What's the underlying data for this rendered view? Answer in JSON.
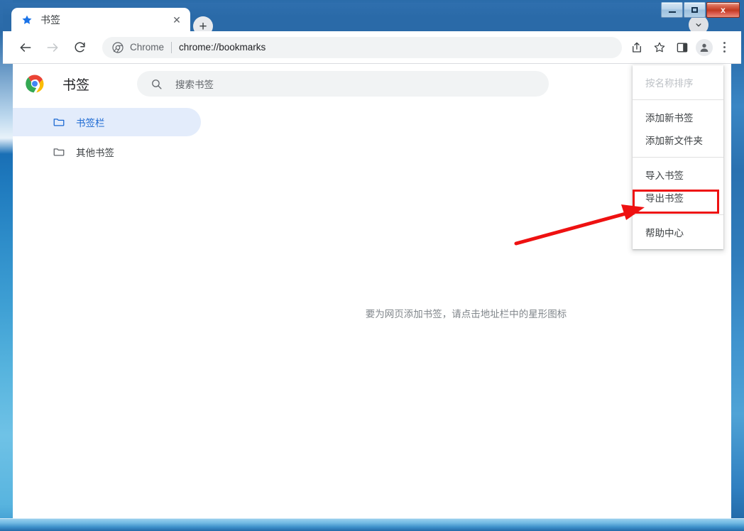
{
  "window": {
    "controls": {
      "minimize_label": "Minimize",
      "maximize_label": "Maximize",
      "close_label": "x"
    }
  },
  "tabstrip": {
    "tabs": [
      {
        "title": "书签",
        "icon": "star-icon",
        "close_label": "✕",
        "active": true
      }
    ],
    "new_tab_label": "+",
    "tab_search_icon": "chevron-down-icon"
  },
  "toolbar": {
    "back_icon": "back-arrow-icon",
    "forward_icon": "forward-arrow-icon",
    "reload_icon": "reload-icon",
    "omnibox": {
      "site_icon": "chrome-icon",
      "scheme_label": "Chrome",
      "url": "chrome://bookmarks"
    },
    "actions": [
      {
        "name": "share-icon",
        "label": "分享"
      },
      {
        "name": "bookmark-star-icon",
        "label": "收藏"
      },
      {
        "name": "side-panel-icon",
        "label": "侧边栏"
      }
    ],
    "avatar_icon": "profile-avatar-icon",
    "menu_icon": "three-dot-menu-icon"
  },
  "bookmark_manager": {
    "logo_icon": "chrome-logo-icon",
    "title": "书签",
    "search": {
      "icon": "search-icon",
      "placeholder": "搜索书签",
      "value": ""
    },
    "sidebar": {
      "items": [
        {
          "label": "书签栏",
          "icon": "folder-icon",
          "selected": true
        },
        {
          "label": "其他书签",
          "icon": "folder-icon",
          "selected": false
        }
      ]
    },
    "empty_state": "要为网页添加书签，请点击地址栏中的星形图标"
  },
  "dropdown_menu": {
    "groups": [
      [
        {
          "label": "按名称排序",
          "disabled": true
        }
      ],
      [
        {
          "label": "添加新书签",
          "disabled": false
        },
        {
          "label": "添加新文件夹",
          "disabled": false
        }
      ],
      [
        {
          "label": "导入书签",
          "disabled": false
        },
        {
          "label": "导出书签",
          "disabled": false,
          "highlighted": true
        }
      ],
      [
        {
          "label": "帮助中心",
          "disabled": false
        }
      ]
    ]
  },
  "annotation": {
    "highlight_color": "#ee1111",
    "target_label": "导出书签"
  }
}
